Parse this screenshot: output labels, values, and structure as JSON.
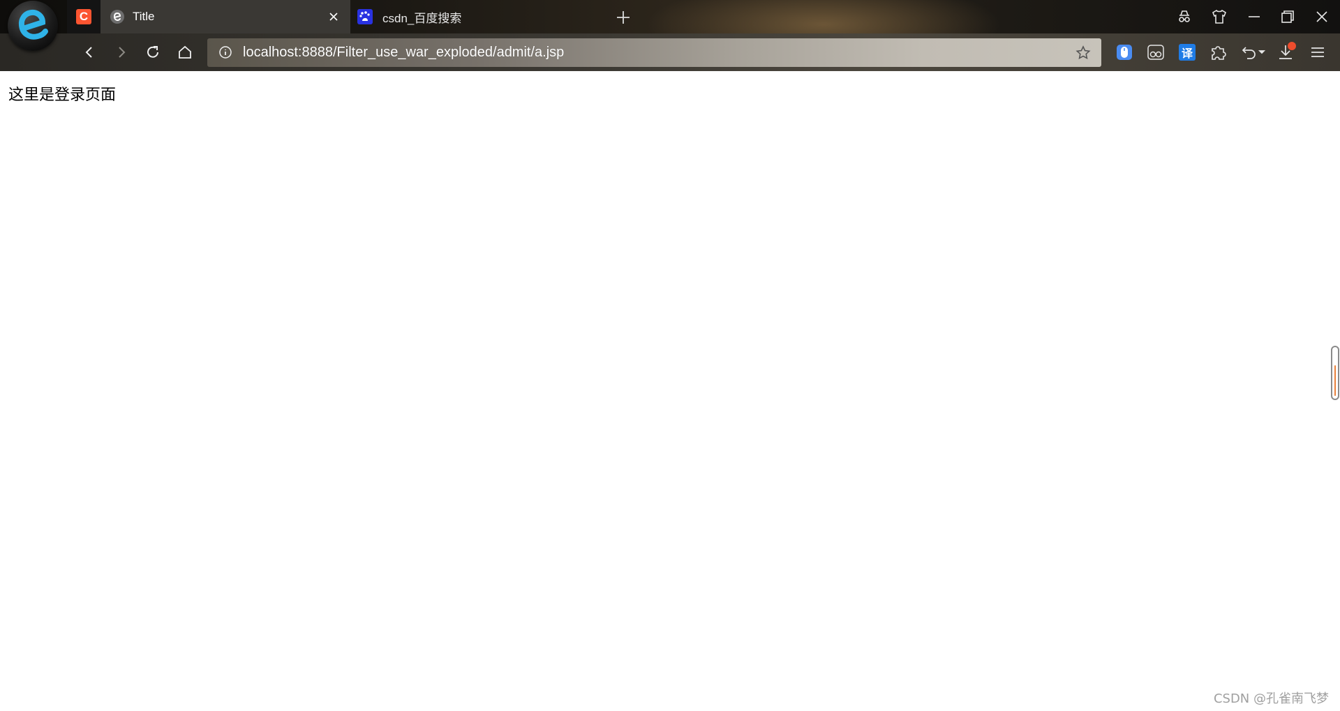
{
  "browser": {
    "logo_icon": "browser-logo-e-icon",
    "pinned_tab": {
      "icon": "csdn-icon",
      "letter": "C",
      "color": "#fc5531"
    },
    "tabs": [
      {
        "label": "Title",
        "icon": "e-favicon-icon",
        "active": true
      },
      {
        "label": "csdn_百度搜索",
        "icon": "baidu-favicon-icon",
        "active": false
      }
    ],
    "new_tab_icon": "plus-icon",
    "window_controls": [
      "incognito-icon",
      "shirt-skin-icon",
      "minimize-icon",
      "restore-icon",
      "close-icon"
    ],
    "toolbar": {
      "nav": [
        "back-icon",
        "forward-icon",
        "reload-icon",
        "home-icon"
      ],
      "url": "localhost:8888/Filter_use_war_exploded/admit/a.jsp",
      "extensions": [
        "mouse-extension-icon",
        "glasses-extension-icon",
        "translate-icon",
        "puzzle-extension-icon",
        "undo-icon",
        "download-icon",
        "menu-icon"
      ],
      "translate_label": "译"
    }
  },
  "page": {
    "text": "这里是登录页面"
  },
  "watermark": "CSDN @孔雀南飞梦",
  "colors": {
    "accent_orange": "#e8803a",
    "csdn_red": "#fc5531",
    "baidu_blue": "#2932e1"
  }
}
